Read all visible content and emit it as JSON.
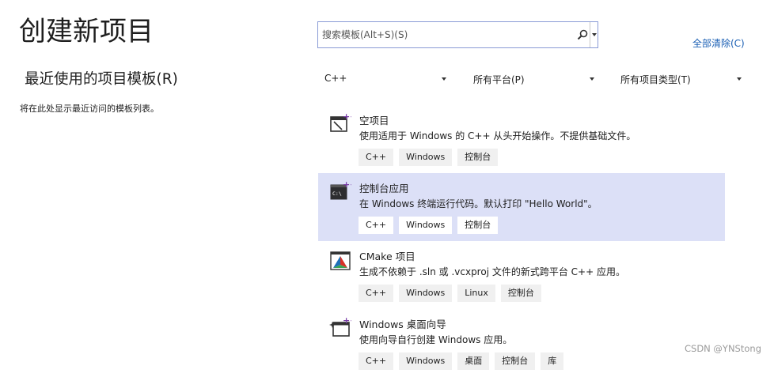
{
  "page": {
    "title": "创建新项目",
    "recent_title": "最近使用的项目模板(R)",
    "recent_empty": "将在此处显示最近访问的模板列表。"
  },
  "search": {
    "placeholder": "搜索模板(Alt+S)(S)",
    "icon": "search-icon"
  },
  "clear_all": "全部清除(C)",
  "filters": {
    "language": "C++",
    "platform": "所有平台(P)",
    "project_type": "所有项目类型(T)"
  },
  "templates": [
    {
      "name": "空项目",
      "description": "使用适用于 Windows 的 C++ 从头开始操作。不提供基础文件。",
      "tags": [
        "C++",
        "Windows",
        "控制台"
      ],
      "icon": "empty-project-icon",
      "selected": false
    },
    {
      "name": "控制台应用",
      "description": "在 Windows 终端运行代码。默认打印 \"Hello World\"。",
      "tags": [
        "C++",
        "Windows",
        "控制台"
      ],
      "icon": "console-app-icon",
      "selected": true
    },
    {
      "name": "CMake 项目",
      "description": "生成不依赖于 .sln 或 .vcxproj 文件的新式跨平台 C++ 应用。",
      "tags": [
        "C++",
        "Windows",
        "Linux",
        "控制台"
      ],
      "icon": "cmake-icon",
      "selected": false
    },
    {
      "name": "Windows 桌面向导",
      "description": "使用向导自行创建 Windows 应用。",
      "tags": [
        "C++",
        "Windows",
        "桌面",
        "控制台",
        "库"
      ],
      "icon": "desktop-wizard-icon",
      "selected": false
    }
  ],
  "watermark": "CSDN @YNStong",
  "colors": {
    "selected_bg": "#dce0f7",
    "link": "#1a5fb4",
    "accent_purple": "#7b3fa8"
  }
}
